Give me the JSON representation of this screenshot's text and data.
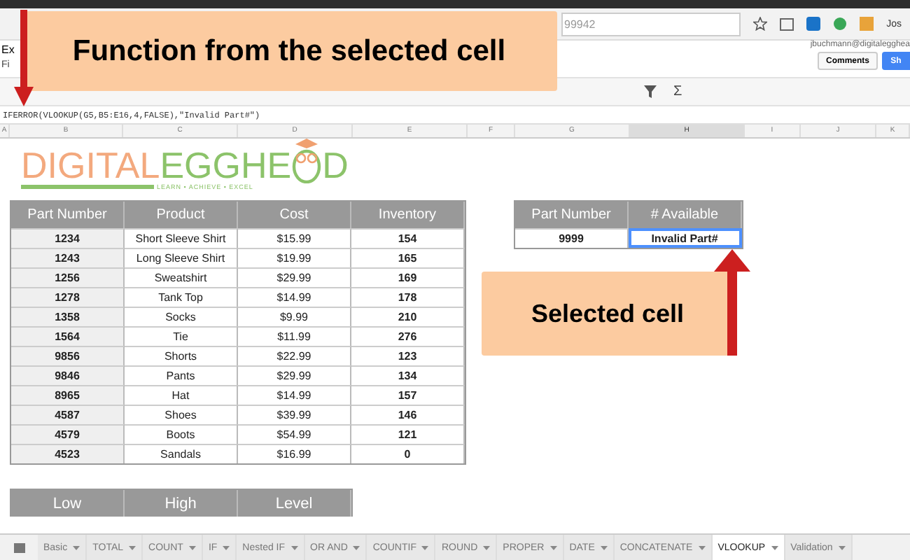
{
  "browser": {
    "address_fragment": "99942",
    "profile": "Jos"
  },
  "doc": {
    "title_fragment": "Ex",
    "menu_fragment": "Fi",
    "account": "jbuchmann@digitalegghea",
    "comments_button": "Comments",
    "share_button": "Sh"
  },
  "toolbar": {
    "sum_symbol": "Σ"
  },
  "formula_bar": {
    "formula": "IFERROR(VLOOKUP(G5,B5:E16,4,FALSE),\"Invalid Part#\")"
  },
  "column_headers": [
    {
      "label": "A",
      "selected": false
    },
    {
      "label": "B",
      "selected": false
    },
    {
      "label": "C",
      "selected": false
    },
    {
      "label": "D",
      "selected": false
    },
    {
      "label": "E",
      "selected": false
    },
    {
      "label": "F",
      "selected": false
    },
    {
      "label": "G",
      "selected": false
    },
    {
      "label": "H",
      "selected": true
    },
    {
      "label": "I",
      "selected": false
    },
    {
      "label": "J",
      "selected": false
    },
    {
      "label": "K",
      "selected": false
    }
  ],
  "logo": {
    "word_1": "DIGITAL",
    "word_2": "EGGHE",
    "word_3": "D",
    "tagline": "LEARN • ACHIEVE • EXCEL"
  },
  "parts_table": {
    "columns": [
      "Part Number",
      "Product",
      "Cost",
      "Inventory"
    ],
    "rows": [
      [
        "1234",
        "Short Sleeve Shirt",
        "$15.99",
        "154"
      ],
      [
        "1243",
        "Long Sleeve Shirt",
        "$19.99",
        "165"
      ],
      [
        "1256",
        "Sweatshirt",
        "$29.99",
        "169"
      ],
      [
        "1278",
        "Tank Top",
        "$14.99",
        "178"
      ],
      [
        "1358",
        "Socks",
        "$9.99",
        "210"
      ],
      [
        "1564",
        "Tie",
        "$11.99",
        "276"
      ],
      [
        "9856",
        "Shorts",
        "$22.99",
        "123"
      ],
      [
        "9846",
        "Pants",
        "$29.99",
        "134"
      ],
      [
        "8965",
        "Hat",
        "$14.99",
        "157"
      ],
      [
        "4587",
        "Shoes",
        "$39.99",
        "146"
      ],
      [
        "4579",
        "Boots",
        "$54.99",
        "121"
      ],
      [
        "4523",
        "Sandals",
        "$16.99",
        "0"
      ]
    ]
  },
  "lookup_table": {
    "columns": [
      "Part Number",
      "# Available"
    ],
    "row": [
      {
        "text": "9999",
        "selected": false
      },
      {
        "text": "Invalid Part#",
        "selected": true
      }
    ]
  },
  "level_table": {
    "columns": [
      "Low",
      "High",
      "Level"
    ]
  },
  "callouts": [
    {
      "text": "Function from the selected cell"
    },
    {
      "text": "Selected cell"
    }
  ],
  "sheet_tabs": [
    {
      "label": "Basic",
      "selected": false
    },
    {
      "label": "TOTAL",
      "selected": false
    },
    {
      "label": "COUNT",
      "selected": false
    },
    {
      "label": "IF",
      "selected": false
    },
    {
      "label": "Nested IF",
      "selected": false
    },
    {
      "label": "OR AND",
      "selected": false
    },
    {
      "label": "COUNTIF",
      "selected": false
    },
    {
      "label": "ROUND",
      "selected": false
    },
    {
      "label": "PROPER",
      "selected": false
    },
    {
      "label": "DATE",
      "selected": false
    },
    {
      "label": "CONCATENATE",
      "selected": false
    },
    {
      "label": "VLOOKUP",
      "selected": true
    },
    {
      "label": "Validation",
      "selected": false
    }
  ]
}
